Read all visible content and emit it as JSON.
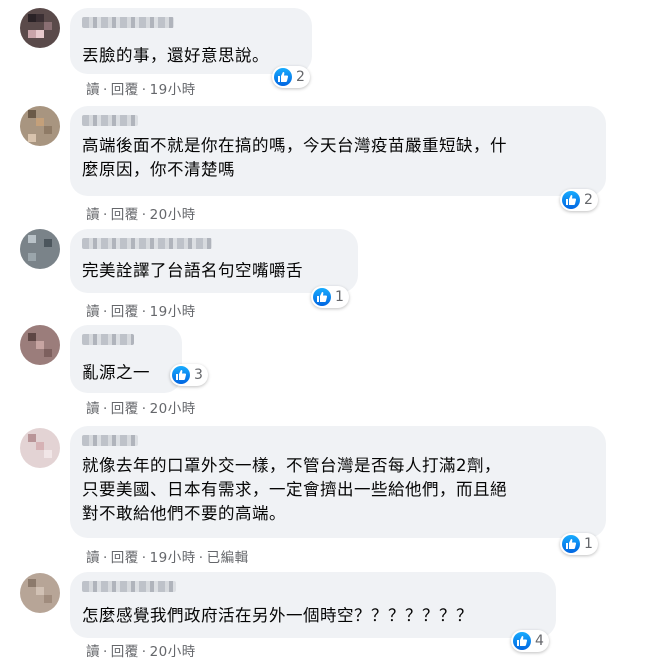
{
  "comments": [
    {
      "text": "丟臉的事，還好意思說。",
      "likes": "2",
      "actions": {
        "read": "讀",
        "reply": "回覆",
        "time": "19小時",
        "edited": ""
      }
    },
    {
      "text": "高端後面不就是你在搞的嗎，今天台灣疫苗嚴重短缺，什\n麼原因，你不清楚嗎",
      "likes": "2",
      "actions": {
        "read": "讀",
        "reply": "回覆",
        "time": "20小時",
        "edited": ""
      }
    },
    {
      "text": "完美詮譯了台語名句空嘴嚼舌",
      "likes": "1",
      "actions": {
        "read": "讀",
        "reply": "回覆",
        "time": "19小時",
        "edited": ""
      }
    },
    {
      "text": "亂源之一",
      "likes": "3",
      "actions": {
        "read": "讀",
        "reply": "回覆",
        "time": "20小時",
        "edited": ""
      }
    },
    {
      "text": "就像去年的口罩外交一樣，不管台灣是否每人打滿2劑，\n只要美國、日本有需求，一定會擠出一些給他們，而且絕\n對不敢給他們不要的高端。",
      "likes": "1",
      "actions": {
        "read": "讀",
        "reply": "回覆",
        "time": "19小時",
        "edited": "已編輯"
      }
    },
    {
      "text": "怎麼感覺我們政府活在另外一個時空？？？？？？？",
      "likes": "4",
      "actions": {
        "read": "讀",
        "reply": "回覆",
        "time": "20小時",
        "edited": ""
      }
    }
  ],
  "separator": "·",
  "colors": {
    "bubble": "#f0f2f5",
    "like_blue": "#1877f2",
    "meta_gray": "#65676b"
  },
  "icons": {
    "like": "thumbs-up-icon"
  }
}
